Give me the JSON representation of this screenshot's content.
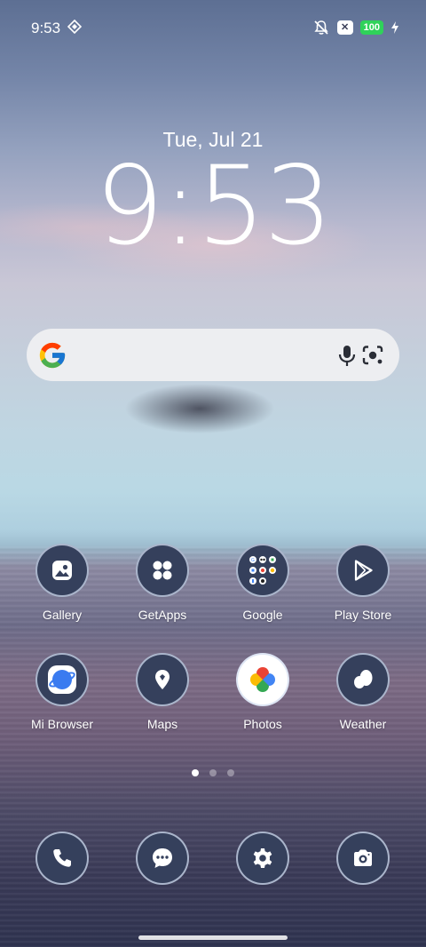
{
  "status_bar": {
    "time": "9:53",
    "battery": "100",
    "colors": {
      "battery": "#2fd25a"
    }
  },
  "lock_clock": {
    "date": "Tue, Jul 21",
    "time": "9:53"
  },
  "search_bar": {
    "icons": [
      "google-g-icon",
      "microphone-icon",
      "google-lens-icon"
    ]
  },
  "apps": [
    {
      "label": "Gallery",
      "icon": "gallery-icon"
    },
    {
      "label": "GetApps",
      "icon": "four-dots-icon"
    },
    {
      "label": "Google",
      "icon": "folder-icon"
    },
    {
      "label": "Play Store",
      "icon": "play-store-icon"
    },
    {
      "label": "Mi Browser",
      "icon": "globe-icon"
    },
    {
      "label": "Maps",
      "icon": "map-pin-icon"
    },
    {
      "label": "Photos",
      "icon": "pinwheel-icon"
    },
    {
      "label": "Weather",
      "icon": "cloud-icon"
    }
  ],
  "page_indicator": {
    "pages": 3,
    "current": 1
  },
  "dock": [
    {
      "icon": "phone-icon"
    },
    {
      "icon": "chat-bubble-icon"
    },
    {
      "icon": "gear-icon"
    },
    {
      "icon": "camera-icon"
    }
  ],
  "colors": {
    "icon_bg": "#35405c",
    "icon_fg": "#ffffff"
  }
}
